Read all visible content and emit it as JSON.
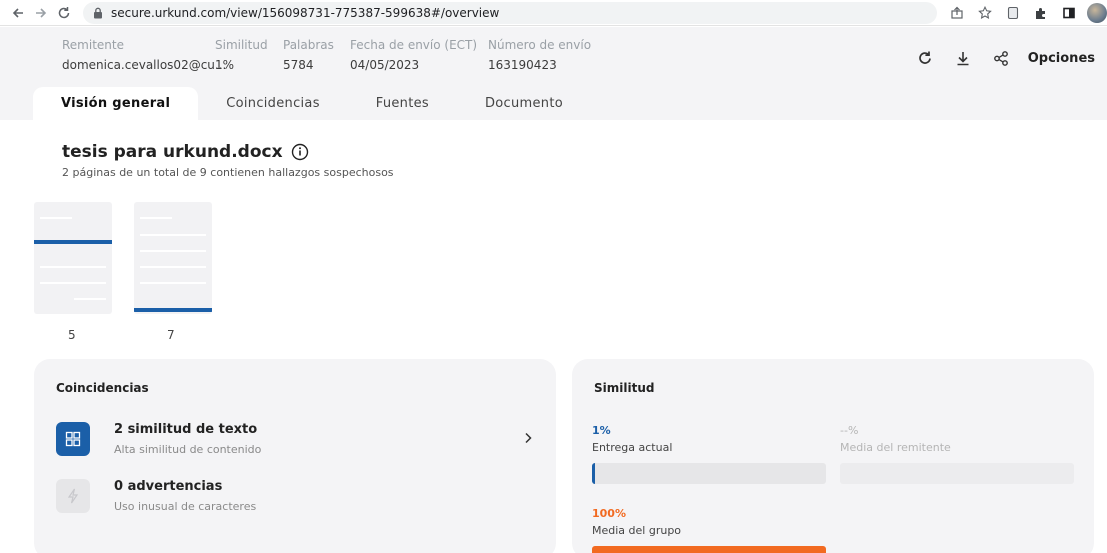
{
  "browser": {
    "url": "secure.urkund.com/view/156098731-775387-599638#/overview"
  },
  "header": {
    "sender_label": "Remitente",
    "sender_value": "domenica.cevallos02@cu...",
    "similarity_label": "Similitud",
    "similarity_value": "1%",
    "words_label": "Palabras",
    "words_value": "5784",
    "date_label": "Fecha de envío (ECT)",
    "date_value": "04/05/2023",
    "submission_label": "Número de envío",
    "submission_value": "163190423",
    "options_label": "Opciones"
  },
  "tabs": [
    {
      "label": "Visión general",
      "active": true
    },
    {
      "label": "Coincidencias",
      "active": false
    },
    {
      "label": "Fuentes",
      "active": false
    },
    {
      "label": "Documento",
      "active": false
    }
  ],
  "document": {
    "title": "tesis para urkund.docx",
    "subtitle": "2 páginas de un total de 9 contienen hallazgos sospechosos",
    "pages": [
      {
        "number": "5"
      },
      {
        "number": "7"
      }
    ]
  },
  "matches_panel": {
    "title": "Coincidencias",
    "items": [
      {
        "title": "2 similitud de texto",
        "subtitle": "Alta similitud de contenido",
        "icon": "grid-icon"
      },
      {
        "title": "0 advertencias",
        "subtitle": "Uso inusual de caracteres",
        "icon": "lightning-icon"
      }
    ]
  },
  "similarity_panel": {
    "title": "Similitud",
    "current_value": "1%",
    "current_label": "Entrega actual",
    "current_fraction": 0.01,
    "sender_avg_value": "--%",
    "sender_avg_label": "Media del remitente",
    "group_value": "100%",
    "group_label": "Media del grupo",
    "group_fraction": 1.0
  },
  "colors": {
    "accent_blue": "#1b5fa8",
    "accent_orange": "#f26a21",
    "panel_bg": "#f4f4f6"
  }
}
